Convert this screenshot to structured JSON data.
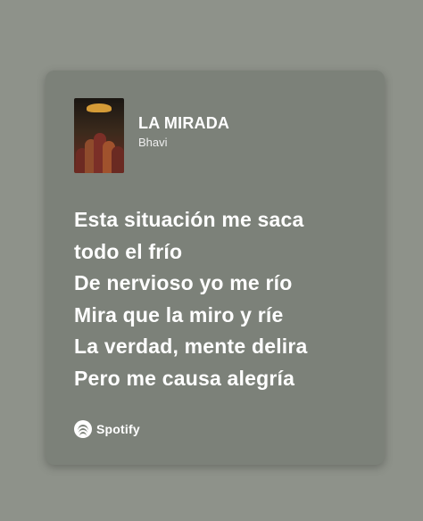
{
  "song": {
    "title": "LA MIRADA",
    "artist": "Bhavi"
  },
  "lyrics": [
    "Esta situación me saca",
    "todo el frío",
    "De nervioso yo me río",
    "Mira que la miro y ríe",
    "La verdad, mente delira",
    "Pero me causa alegría"
  ],
  "branding": {
    "name": "Spotify",
    "icon": "spotify-logo"
  },
  "colors": {
    "background": "#8e928a",
    "card": "#7c8179",
    "text": "#ffffff"
  }
}
